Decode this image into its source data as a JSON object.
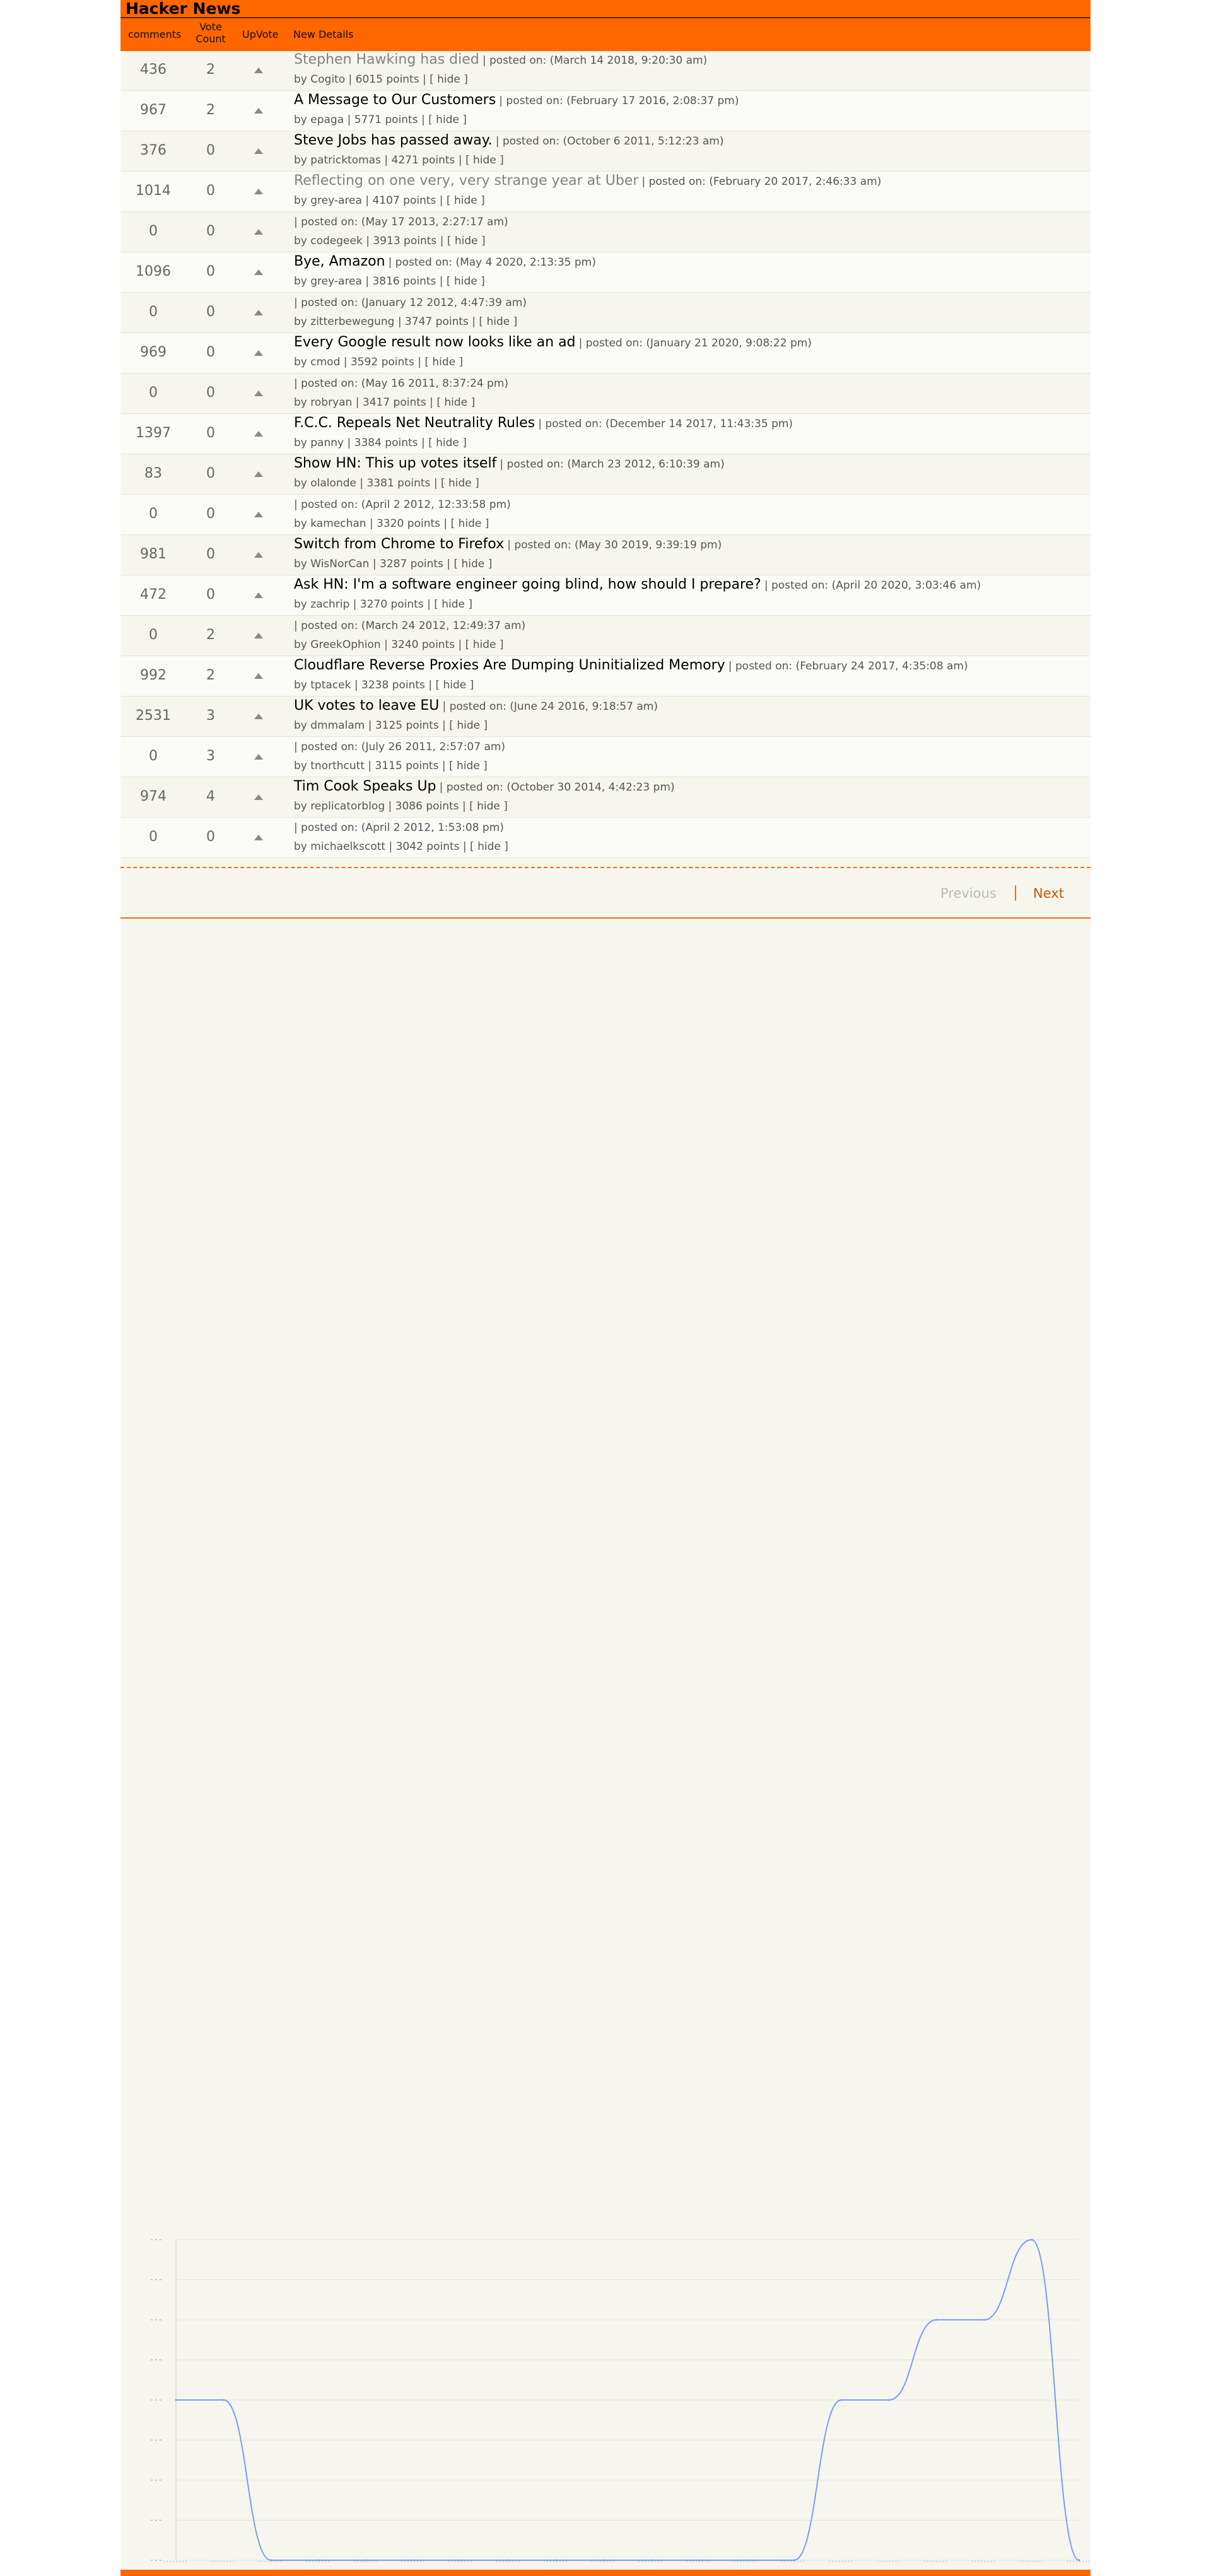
{
  "site": {
    "title": "Hacker News"
  },
  "header": {
    "comments": "comments",
    "vote_count_1": "Vote",
    "vote_count_2": "Count",
    "upvote": "UpVote",
    "details": "New Details"
  },
  "stories": [
    {
      "comments": "436",
      "votes": "2",
      "title": "Stephen Hawking has died",
      "posted": "| posted on: (March 14 2018, 9:20:30 am)",
      "author": "Cogito",
      "points": "6015 points",
      "visited": true
    },
    {
      "comments": "967",
      "votes": "2",
      "title": "A Message to Our Customers",
      "posted": "| posted on: (February 17 2016, 2:08:37 pm)",
      "author": "epaga",
      "points": "5771 points",
      "visited": false
    },
    {
      "comments": "376",
      "votes": "0",
      "title": "Steve Jobs has passed away.",
      "posted": "| posted on: (October 6 2011, 5:12:23 am)",
      "author": "patricktomas",
      "points": "4271 points",
      "visited": false
    },
    {
      "comments": "1014",
      "votes": "0",
      "title": "Reflecting on one very, very strange year at Uber",
      "posted": "| posted on: (February 20 2017, 2:46:33 am)",
      "author": "grey-area",
      "points": "4107 points",
      "visited": true
    },
    {
      "comments": "0",
      "votes": "0",
      "title": "",
      "posted": "| posted on: (May 17 2013, 2:27:17 am)",
      "author": "codegeek",
      "points": "3913 points",
      "visited": false
    },
    {
      "comments": "1096",
      "votes": "0",
      "title": "Bye, Amazon",
      "posted": "| posted on: (May 4 2020, 2:13:35 pm)",
      "author": "grey-area",
      "points": "3816 points",
      "visited": false
    },
    {
      "comments": "0",
      "votes": "0",
      "title": "",
      "posted": "| posted on: (January 12 2012, 4:47:39 am)",
      "author": "zitterbewegung",
      "points": "3747 points",
      "visited": false
    },
    {
      "comments": "969",
      "votes": "0",
      "title": "Every Google result now looks like an ad",
      "posted": "| posted on: (January 21 2020, 9:08:22 pm)",
      "author": "cmod",
      "points": "3592 points",
      "visited": false
    },
    {
      "comments": "0",
      "votes": "0",
      "title": "",
      "posted": "| posted on: (May 16 2011, 8:37:24 pm)",
      "author": "robryan",
      "points": "3417 points",
      "visited": false
    },
    {
      "comments": "1397",
      "votes": "0",
      "title": "F.C.C. Repeals Net Neutrality Rules",
      "posted": "| posted on: (December 14 2017, 11:43:35 pm)",
      "author": "panny",
      "points": "3384 points",
      "visited": false
    },
    {
      "comments": "83",
      "votes": "0",
      "title": "Show HN: This up votes itself",
      "posted": "| posted on: (March 23 2012, 6:10:39 am)",
      "author": "olalonde",
      "points": "3381 points",
      "visited": false
    },
    {
      "comments": "0",
      "votes": "0",
      "title": "",
      "posted": "| posted on: (April 2 2012, 12:33:58 pm)",
      "author": "kamechan",
      "points": "3320 points",
      "visited": false
    },
    {
      "comments": "981",
      "votes": "0",
      "title": "Switch from Chrome to Firefox",
      "posted": "| posted on: (May 30 2019, 9:39:19 pm)",
      "author": "WisNorCan",
      "points": "3287 points",
      "visited": false
    },
    {
      "comments": "472",
      "votes": "0",
      "title": "Ask HN: I'm a software engineer going blind, how should I prepare?",
      "posted": "| posted on: (April 20 2020, 3:03:46 am)",
      "author": "zachrip",
      "points": "3270 points",
      "visited": false
    },
    {
      "comments": "0",
      "votes": "2",
      "title": "",
      "posted": "| posted on: (March 24 2012, 12:49:37 am)",
      "author": "GreekOphion",
      "points": "3240 points",
      "visited": false
    },
    {
      "comments": "992",
      "votes": "2",
      "title": "Cloudflare Reverse Proxies Are Dumping Uninitialized Memory",
      "posted": "| posted on: (February 24 2017, 4:35:08 am)",
      "author": "tptacek",
      "points": "3238 points",
      "visited": false
    },
    {
      "comments": "2531",
      "votes": "3",
      "title": "UK votes to leave EU",
      "posted": "| posted on: (June 24 2016, 9:18:57 am)",
      "author": "dmmalam",
      "points": "3125 points",
      "visited": false
    },
    {
      "comments": "0",
      "votes": "3",
      "title": "",
      "posted": "| posted on: (July 26 2011, 2:57:07 am)",
      "author": "tnorthcutt",
      "points": "3115 points",
      "visited": false
    },
    {
      "comments": "974",
      "votes": "4",
      "title": "Tim Cook Speaks Up",
      "posted": "| posted on: (October 30 2014, 4:42:23 pm)",
      "author": "replicatorblog",
      "points": "3086 points",
      "visited": false
    },
    {
      "comments": "0",
      "votes": "0",
      "title": "",
      "posted": "| posted on: (April 2 2012, 1:53:08 pm)",
      "author": "michaelkscott",
      "points": "3042 points",
      "visited": false
    }
  ],
  "labels": {
    "by": "by",
    "sep": "|",
    "hide": "[ hide ]"
  },
  "pager": {
    "previous": "Previous",
    "separator": "|",
    "next": "Next"
  },
  "colors": {
    "accent": "#ff6600",
    "line": "#7b9cf5",
    "grid": "#e4e4dc"
  },
  "chart_data": {
    "type": "line",
    "x": [
      1,
      2,
      3,
      4,
      5,
      6,
      7,
      8,
      9,
      10,
      11,
      12,
      13,
      14,
      15,
      16,
      17,
      18,
      19,
      20
    ],
    "series": [
      {
        "values": [
          2,
          2,
          0,
          0,
          0,
          0,
          0,
          0,
          0,
          0,
          0,
          0,
          0,
          0,
          2,
          2,
          3,
          3,
          4,
          0
        ]
      }
    ],
    "ylim": [
      0,
      4
    ],
    "grid": true
  }
}
